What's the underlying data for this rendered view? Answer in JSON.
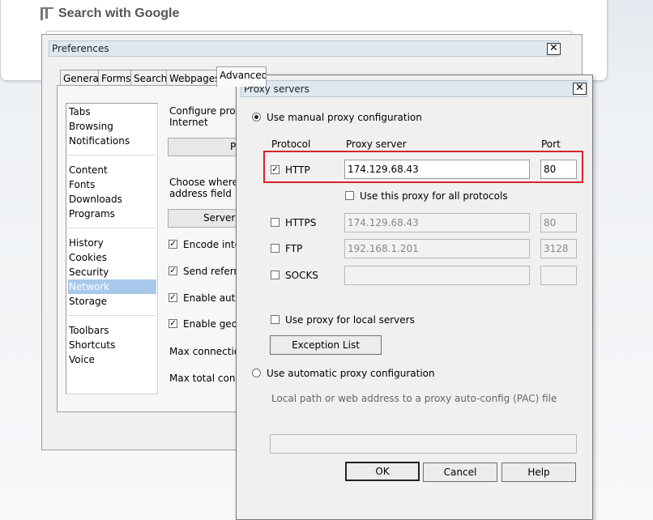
{
  "browser": {
    "search_title": "Search with Google"
  },
  "preferences": {
    "title": "Preferences",
    "tabs": [
      "General",
      "Forms",
      "Search",
      "Webpages",
      "Advanced"
    ],
    "categories": [
      [
        "Tabs",
        "Browsing",
        "Notifications"
      ],
      [
        "Content",
        "Fonts",
        "Downloads",
        "Programs"
      ],
      [
        "History",
        "Cookies",
        "Security",
        "Network",
        "Storage"
      ],
      [
        "Toolbars",
        "Shortcuts",
        "Voice"
      ]
    ],
    "selected_category": "Network",
    "pane": {
      "configure_proxy_text_1": "Configure proxy",
      "configure_proxy_text_2": "Internet",
      "proxy_button": "P",
      "choose_where_text_1": "Choose where C",
      "choose_where_text_2": "address field",
      "server_button": "Server N",
      "encode_label": "Encode inter",
      "send_referrer_label": "Send referrer",
      "enable_auto_label": "Enable autor",
      "enable_geo_label": "Enable geolo",
      "max_connections_label": "Max connection",
      "max_total_label": "Max total conne"
    }
  },
  "proxy_dialog": {
    "title": "Proxy servers",
    "manual_label": "Use manual proxy configuration",
    "headers": {
      "protocol": "Protocol",
      "server": "Proxy server",
      "port": "Port"
    },
    "rows": [
      {
        "protocol": "HTTP",
        "checked": true,
        "server": "174.129.68.43",
        "port": "80",
        "enabled": true
      },
      {
        "protocol": "HTTPS",
        "checked": false,
        "server": "174.129.68.43",
        "port": "80",
        "enabled": false
      },
      {
        "protocol": "FTP",
        "checked": false,
        "server": "192.168.1.201",
        "port": "3128",
        "enabled": false
      },
      {
        "protocol": "SOCKS",
        "checked": false,
        "server": "",
        "port": "",
        "enabled": false
      }
    ],
    "all_protocols_label": "Use this proxy for all protocols",
    "local_servers_label": "Use proxy for local servers",
    "exception_button": "Exception List",
    "automatic_label": "Use automatic proxy configuration",
    "pac_label": "Local path or web address to a proxy auto-config (PAC) file",
    "pac_value": "",
    "ok": "OK",
    "cancel": "Cancel",
    "help": "Help",
    "highlight_color": "#d2262b"
  }
}
